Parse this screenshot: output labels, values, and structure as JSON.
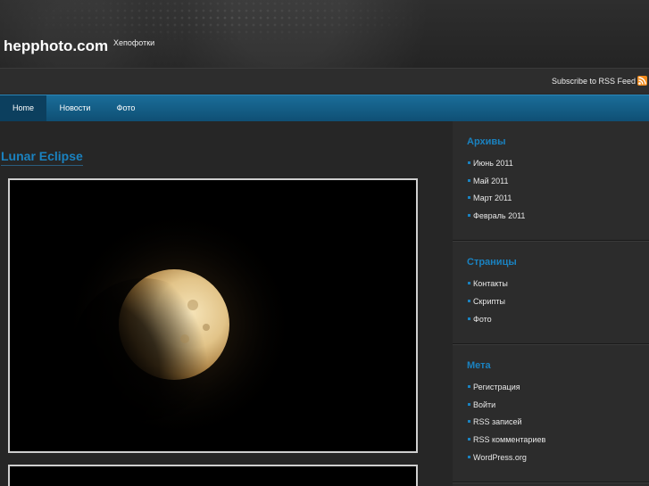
{
  "header": {
    "site_title": "hepphoto.com",
    "site_description": "Хепофотки"
  },
  "subscribe": {
    "label": "Subscribe to RSS Feed",
    "icon": "rss-icon"
  },
  "nav": {
    "items": [
      {
        "label": "Home"
      },
      {
        "label": "Новости"
      },
      {
        "label": "Фото"
      }
    ]
  },
  "post": {
    "title": "Lunar Eclipse"
  },
  "sidebar": {
    "archives": {
      "title": "Архивы",
      "items": [
        "Июнь 2011",
        "Май 2011",
        "Март 2011",
        "Февраль 2011"
      ]
    },
    "pages": {
      "title": "Страницы",
      "items": [
        "Контакты",
        "Скрипты",
        "Фото"
      ]
    },
    "meta": {
      "title": "Мета",
      "items": [
        "Регистрация",
        "Войти",
        "RSS записей",
        "RSS комментариев",
        "WordPress.org"
      ]
    }
  },
  "colors": {
    "accent": "#1a82c0",
    "nav": "#0f5a84",
    "background": "#262626"
  }
}
